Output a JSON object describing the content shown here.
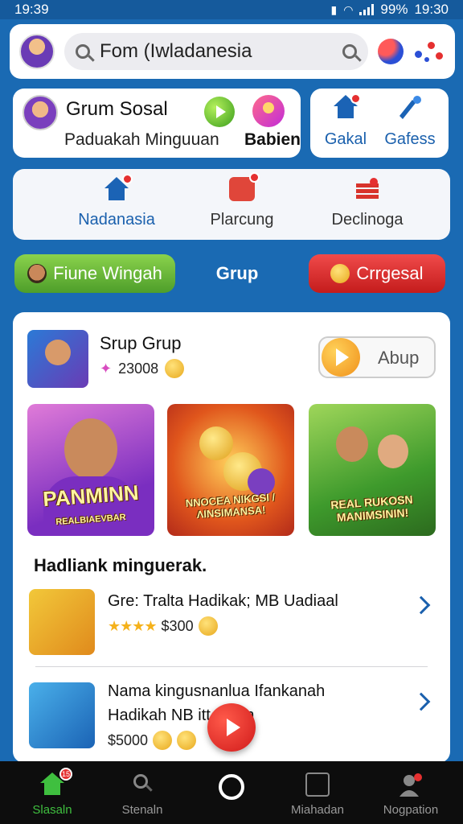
{
  "status_bar": {
    "time_left": "19:39",
    "battery": "99%",
    "time_right": "19:30"
  },
  "search": {
    "value": "Fom (Iwladanesia"
  },
  "profile": {
    "name": "Grum Sosal",
    "subtitle": "Paduakah Minguuan",
    "action_label": "Babien"
  },
  "shortcuts": [
    {
      "label": "Gakal",
      "icon": "home-icon"
    },
    {
      "label": "Gafess",
      "icon": "megaphone-icon"
    }
  ],
  "nav": [
    {
      "label": "Nadanasia",
      "icon": "home-icon"
    },
    {
      "label": "Plarcung",
      "icon": "share-icon"
    },
    {
      "label": "Declinoga",
      "icon": "stack-icon"
    }
  ],
  "pills": {
    "left": "Fiune Wingah",
    "center": "Grup",
    "right": "Crrgesal"
  },
  "group": {
    "title": "Srup Grup",
    "count": "23008",
    "action_label": "Abup"
  },
  "tiles": [
    {
      "caption": "PANMINN",
      "subcaption": "REALBIAEVBAR"
    },
    {
      "caption": "NNOCEA NIKGSI / ΛINSIMANSA!"
    },
    {
      "caption": "REAL RUKOSN MANIMSININ!"
    }
  ],
  "section_title": "Hadliank minguerak.",
  "list": [
    {
      "title": "Gre: Tralta Hadikak; MB Uadiaal",
      "stars": "★★★★",
      "price": "$300"
    },
    {
      "title_line1": "Nama kingusnanlua Ifankanah",
      "title_line2": "Hadikah NB itt  adion",
      "price": "$5000"
    }
  ],
  "bottom_nav": [
    {
      "label": "Slasaln",
      "icon": "home-icon",
      "badge": "15"
    },
    {
      "label": "Stenaln",
      "icon": "search-icon"
    },
    {
      "label": "Miahadan",
      "icon": "document-icon"
    },
    {
      "label": "Nogpation",
      "icon": "person-icon"
    }
  ],
  "colors": {
    "accent": "#1a6ab3",
    "green": "#4e9e2a",
    "red": "#c41c1c",
    "link": "#1a60ad"
  }
}
